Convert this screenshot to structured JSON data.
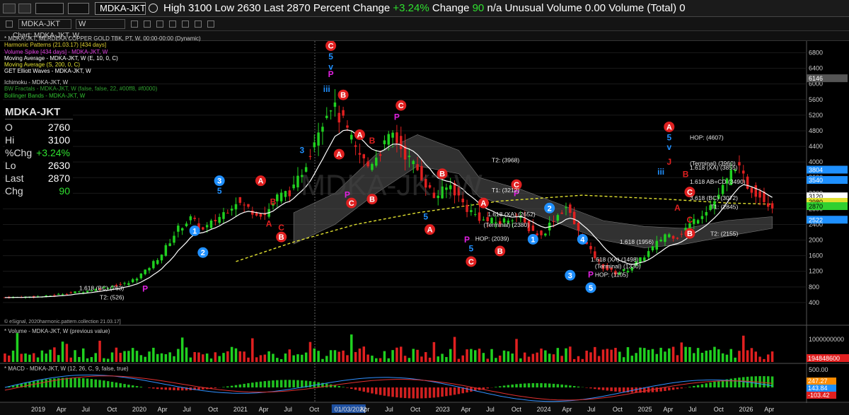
{
  "topbar": {
    "symbol": "MDKA-JKT",
    "quote_text": "High 3100  Low 2630  Last 2870  Percent Change ",
    "pct_change": "+3.24%",
    "change_label": "  Change ",
    "change_value": "90",
    "rest_text": "  n/a  Unusual Volume 0.00  Volume (Total) 0"
  },
  "toolbar": {
    "interval": "W"
  },
  "chart_title": "Chart: MDKA-JKT, W",
  "legend": [
    {
      "text": "* MDKA-JKT, MERDEKA COPPER GOLD TBK, PT, W, 00:00-00:00 (Dynamic)",
      "color": "#cccccc"
    },
    {
      "text": "Harmonic Patterns (21.03.17) [434 days]",
      "color": "#e0d030"
    },
    {
      "text": "Volume Spike [434 days] - MDKA-JKT, W",
      "color": "#e040e0"
    },
    {
      "text": "Moving Average - MDKA-JKT, W (E, 10, 0, C)",
      "color": "#ffffff"
    },
    {
      "text": "Moving Average (S, 200, 0, C)",
      "color": "#e0e030"
    },
    {
      "text": "GET Elliott Waves - MDKA-JKT, W",
      "color": "#ffffff"
    }
  ],
  "legend2": [
    {
      "text": "Ichimoku - MDKA-JKT, W",
      "color": "#cccccc"
    },
    {
      "text": "BW Fractals - MDKA-JKT, W (false, false, 22, #00ff8, #f0000)",
      "color": "#30a030"
    },
    {
      "text": "Bollinger Bands - MDKA-JKT, W",
      "color": "#30c030"
    }
  ],
  "quote_box": {
    "symbol": "MDKA-JKT",
    "rows": [
      {
        "label": "O",
        "value": "2760",
        "green": false
      },
      {
        "label": "Hi",
        "value": "3100",
        "green": false
      },
      {
        "label": "%Chg",
        "value": "+3.24%",
        "green": true
      },
      {
        "label": "Lo",
        "value": "2630",
        "green": false
      },
      {
        "label": "Last",
        "value": "2870",
        "green": false
      },
      {
        "label": "Chg",
        "value": "90",
        "green": true
      }
    ]
  },
  "credit": "© eSignal, 2020harmonic.pattern.collection 21.03.17]",
  "volume_label": "* Volume - MDKA-JKT, W (previous value)",
  "macd_label": "* MACD - MDKA-JKT, W (12, 26, C, 9, false, true)",
  "watermark": "MDKA-JKT,W",
  "chart_data": {
    "type": "candlestick",
    "price_axis": {
      "ticks": [
        400,
        800,
        1200,
        1600,
        2000,
        2400,
        2800,
        3200,
        3600,
        4000,
        4400,
        4800,
        5200,
        5600,
        6000,
        6400,
        6800
      ],
      "range": [
        0,
        7100
      ]
    },
    "price_tags": [
      {
        "value": 6146,
        "label": "6146",
        "bg": "#555555",
        "fg": "#ffffff"
      },
      {
        "value": 3804,
        "label": "3804",
        "bg": "#1e90ff",
        "fg": "#ffffff"
      },
      {
        "value": 3540,
        "label": "3540",
        "bg": "#1e90ff",
        "fg": "#ffffff"
      },
      {
        "value": 3120,
        "label": "3120",
        "bg": "#ffffff",
        "fg": "#000000"
      },
      {
        "value": 2980,
        "label": "2980",
        "bg": "#e0e030",
        "fg": "#000000"
      },
      {
        "value": 2870,
        "label": "2870",
        "bg": "#30d030",
        "fg": "#000000"
      },
      {
        "value": 2522,
        "label": "2522",
        "bg": "#1e90ff",
        "fg": "#ffffff"
      }
    ],
    "time_labels": [
      "2019",
      "Apr",
      "Jul",
      "Oct",
      "2020",
      "Apr",
      "Jul",
      "Oct",
      "2021",
      "Apr",
      "Jul",
      "Oct",
      "01/03/2022",
      "Apr",
      "Jul",
      "Oct",
      "2023",
      "Apr",
      "Jul",
      "Oct",
      "2024",
      "Apr",
      "Jul",
      "Oct",
      "2025",
      "Apr",
      "Jul",
      "Oct",
      "2026",
      "Apr"
    ],
    "close_path": [
      [
        0,
        530
      ],
      [
        10,
        560
      ],
      [
        15,
        640
      ],
      [
        20,
        700
      ],
      [
        25,
        800
      ],
      [
        30,
        900
      ],
      [
        34,
        1200
      ],
      [
        38,
        1650
      ],
      [
        42,
        2300
      ],
      [
        45,
        2550
      ],
      [
        48,
        2250
      ],
      [
        52,
        2600
      ],
      [
        56,
        3000
      ],
      [
        60,
        2750
      ],
      [
        63,
        2650
      ],
      [
        66,
        3100
      ],
      [
        70,
        3300
      ],
      [
        73,
        4000
      ],
      [
        76,
        4900
      ],
      [
        79,
        5500
      ],
      [
        82,
        5000
      ],
      [
        85,
        4300
      ],
      [
        88,
        3900
      ],
      [
        91,
        4300
      ],
      [
        94,
        4700
      ],
      [
        97,
        4200
      ],
      [
        100,
        3800
      ],
      [
        104,
        3100
      ],
      [
        108,
        3400
      ],
      [
        112,
        2800
      ],
      [
        116,
        2500
      ],
      [
        120,
        2450
      ],
      [
        124,
        2650
      ],
      [
        127,
        2300
      ],
      [
        130,
        2100
      ],
      [
        133,
        2550
      ],
      [
        136,
        2850
      ],
      [
        139,
        2200
      ],
      [
        142,
        1700
      ],
      [
        145,
        1300
      ],
      [
        148,
        1150
      ],
      [
        151,
        1250
      ],
      [
        154,
        1500
      ],
      [
        157,
        1800
      ],
      [
        160,
        2150
      ],
      [
        163,
        2100
      ],
      [
        166,
        2400
      ],
      [
        169,
        2700
      ],
      [
        172,
        3000
      ],
      [
        175,
        3500
      ],
      [
        177,
        3950
      ],
      [
        180,
        3400
      ],
      [
        183,
        3150
      ],
      [
        186,
        2870
      ]
    ],
    "bars_total": 190,
    "ma200_path": [
      [
        56,
        1450
      ],
      [
        70,
        1950
      ],
      [
        85,
        2400
      ],
      [
        100,
        2700
      ],
      [
        120,
        3000
      ],
      [
        140,
        3150
      ],
      [
        160,
        3050
      ],
      [
        175,
        2950
      ],
      [
        186,
        2920
      ]
    ],
    "cloud_upper": [
      [
        70,
        2700
      ],
      [
        80,
        3200
      ],
      [
        90,
        4200
      ],
      [
        100,
        4700
      ],
      [
        110,
        4300
      ],
      [
        115,
        3600
      ],
      [
        125,
        3300
      ],
      [
        135,
        2900
      ],
      [
        145,
        2500
      ],
      [
        155,
        2350
      ],
      [
        165,
        2300
      ],
      [
        175,
        2500
      ],
      [
        186,
        2600
      ]
    ],
    "cloud_lower": [
      [
        70,
        1900
      ],
      [
        80,
        2400
      ],
      [
        90,
        3200
      ],
      [
        100,
        3900
      ],
      [
        110,
        3700
      ],
      [
        115,
        3100
      ],
      [
        125,
        2800
      ],
      [
        135,
        2400
      ],
      [
        145,
        2000
      ],
      [
        155,
        1800
      ],
      [
        165,
        1900
      ],
      [
        175,
        2100
      ],
      [
        186,
        2300
      ]
    ],
    "wave_labels": [
      {
        "i": 79,
        "v": 6980,
        "text": "C",
        "kind": "circle",
        "color": "#e02020"
      },
      {
        "i": 79,
        "v": 6700,
        "text": "5",
        "kind": "text",
        "color": "#2090ff"
      },
      {
        "i": 79,
        "v": 6440,
        "text": "v",
        "kind": "text",
        "color": "#2090ff"
      },
      {
        "i": 79,
        "v": 6250,
        "text": "P",
        "kind": "text",
        "color": "#e020e0"
      },
      {
        "i": 78,
        "v": 5870,
        "text": "iii",
        "kind": "text",
        "color": "#2090ff"
      },
      {
        "i": 82,
        "v": 5720,
        "text": "B",
        "kind": "circle",
        "color": "#e02020"
      },
      {
        "i": 96,
        "v": 5450,
        "text": "C",
        "kind": "circle",
        "color": "#e02020"
      },
      {
        "i": 95,
        "v": 5150,
        "text": "P",
        "kind": "text",
        "color": "#e020e0"
      },
      {
        "i": 86,
        "v": 4700,
        "text": "A",
        "kind": "circle",
        "color": "#e02020"
      },
      {
        "i": 89,
        "v": 4550,
        "text": "B",
        "kind": "text",
        "color": "#e02020"
      },
      {
        "i": 81,
        "v": 4200,
        "text": "A",
        "kind": "circle",
        "color": "#e02020"
      },
      {
        "i": 72,
        "v": 4300,
        "text": "3",
        "kind": "text",
        "color": "#2090ff"
      },
      {
        "i": 52,
        "v": 3520,
        "text": "3",
        "kind": "circle",
        "color": "#2090ff"
      },
      {
        "i": 52,
        "v": 3260,
        "text": "5",
        "kind": "text",
        "color": "#2090ff"
      },
      {
        "i": 62,
        "v": 3520,
        "text": "A",
        "kind": "circle",
        "color": "#e02020"
      },
      {
        "i": 65,
        "v": 2980,
        "text": "B",
        "kind": "text",
        "color": "#e02020"
      },
      {
        "i": 64,
        "v": 2420,
        "text": "A",
        "kind": "text",
        "color": "#e02020"
      },
      {
        "i": 67,
        "v": 2320,
        "text": "C",
        "kind": "text",
        "color": "#e02020"
      },
      {
        "i": 67,
        "v": 2080,
        "text": "B",
        "kind": "circle",
        "color": "#e02020"
      },
      {
        "i": 46,
        "v": 2240,
        "text": "1",
        "kind": "circle",
        "color": "#2090ff"
      },
      {
        "i": 48,
        "v": 1680,
        "text": "2",
        "kind": "circle",
        "color": "#2090ff"
      },
      {
        "i": 34,
        "v": 750,
        "text": "P",
        "kind": "text",
        "color": "#e020e0"
      },
      {
        "i": 83,
        "v": 3160,
        "text": "P",
        "kind": "text",
        "color": "#e020e0"
      },
      {
        "i": 84,
        "v": 2950,
        "text": "C",
        "kind": "circle",
        "color": "#e02020"
      },
      {
        "i": 89,
        "v": 3050,
        "text": "B",
        "kind": "circle",
        "color": "#e02020"
      },
      {
        "i": 106,
        "v": 3700,
        "text": "B",
        "kind": "circle",
        "color": "#e02020"
      },
      {
        "i": 102,
        "v": 2600,
        "text": "5",
        "kind": "text",
        "color": "#2090ff"
      },
      {
        "i": 103,
        "v": 2270,
        "text": "A",
        "kind": "circle",
        "color": "#e02020"
      },
      {
        "i": 116,
        "v": 2950,
        "text": "A",
        "kind": "circle",
        "color": "#e02020"
      },
      {
        "i": 124,
        "v": 3420,
        "text": "C",
        "kind": "circle",
        "color": "#e02020"
      },
      {
        "i": 124,
        "v": 3200,
        "text": "P",
        "kind": "text",
        "color": "#e020e0"
      },
      {
        "i": 132,
        "v": 2820,
        "text": "2",
        "kind": "circle",
        "color": "#2090ff"
      },
      {
        "i": 128,
        "v": 2020,
        "text": "1",
        "kind": "circle",
        "color": "#2090ff"
      },
      {
        "i": 112,
        "v": 2010,
        "text": "P",
        "kind": "text",
        "color": "#e020e0"
      },
      {
        "i": 113,
        "v": 1780,
        "text": "5",
        "kind": "text",
        "color": "#2090ff"
      },
      {
        "i": 113,
        "v": 1450,
        "text": "C",
        "kind": "circle",
        "color": "#e02020"
      },
      {
        "i": 120,
        "v": 1720,
        "text": "B",
        "kind": "circle",
        "color": "#e02020"
      },
      {
        "i": 140,
        "v": 2020,
        "text": "4",
        "kind": "circle",
        "color": "#2090ff"
      },
      {
        "i": 137,
        "v": 1100,
        "text": "3",
        "kind": "circle",
        "color": "#2090ff"
      },
      {
        "i": 142,
        "v": 1110,
        "text": "P",
        "kind": "text",
        "color": "#e020e0"
      },
      {
        "i": 142,
        "v": 780,
        "text": "5",
        "kind": "circle",
        "color": "#2090ff"
      },
      {
        "i": 161,
        "v": 4900,
        "text": "A",
        "kind": "circle",
        "color": "#e02020"
      },
      {
        "i": 161,
        "v": 4630,
        "text": "5",
        "kind": "text",
        "color": "#2090ff"
      },
      {
        "i": 161,
        "v": 4380,
        "text": "v",
        "kind": "text",
        "color": "#2090ff"
      },
      {
        "i": 161,
        "v": 4000,
        "text": "J",
        "kind": "text",
        "color": "#e02020"
      },
      {
        "i": 165,
        "v": 3690,
        "text": "B",
        "kind": "text",
        "color": "#e02020"
      },
      {
        "i": 166,
        "v": 3230,
        "text": "C",
        "kind": "circle",
        "color": "#e02020"
      },
      {
        "i": 166,
        "v": 2520,
        "text": "C",
        "kind": "text",
        "color": "#e02020"
      },
      {
        "i": 166,
        "v": 2170,
        "text": "B",
        "kind": "circle",
        "color": "#e02020"
      },
      {
        "i": 163,
        "v": 2830,
        "text": "A",
        "kind": "text",
        "color": "#e02020"
      },
      {
        "i": 159,
        "v": 3750,
        "text": "iii",
        "kind": "text",
        "color": "#2090ff"
      }
    ],
    "annotations": [
      {
        "i": 118,
        "v": 4050,
        "text": "T2: (3968)"
      },
      {
        "i": 118,
        "v": 3280,
        "text": "T1: (3212)"
      },
      {
        "i": 166,
        "v": 4630,
        "text": "HOP: (4607)"
      },
      {
        "i": 166,
        "v": 3970,
        "text": "(Terminal) (3960)"
      },
      {
        "i": 166,
        "v": 3860,
        "text": "1.618 (XA) (3855)"
      },
      {
        "i": 166,
        "v": 3500,
        "text": "1.618 AB=CD (3490)"
      },
      {
        "i": 166,
        "v": 3080,
        "text": "3.618 (BC) (3072)"
      },
      {
        "i": 171,
        "v": 2850,
        "text": "T1: (2845)"
      },
      {
        "i": 171,
        "v": 2160,
        "text": "T2: (2155)"
      },
      {
        "i": 117,
        "v": 2660,
        "text": "1.618 (XA) (2652)"
      },
      {
        "i": 116,
        "v": 2390,
        "text": "(Terminal) (2380)"
      },
      {
        "i": 114,
        "v": 2040,
        "text": "HOP: (2039)"
      },
      {
        "i": 149,
        "v": 1960,
        "text": "1.618 (1956)"
      },
      {
        "i": 142,
        "v": 1500,
        "text": "1.618 (XA) (1498)"
      },
      {
        "i": 143,
        "v": 1330,
        "text": "(Terminal) (1330)"
      },
      {
        "i": 143,
        "v": 1110,
        "text": "HOP: (1105)"
      },
      {
        "i": 18,
        "v": 770,
        "text": "1.618 (BC) (763)"
      },
      {
        "i": 23,
        "v": 530,
        "text": "T2: (526)"
      }
    ],
    "volume_axis": {
      "ticks": [
        {
          "value": 1000000000,
          "label": "1000000000"
        }
      ],
      "last": "194848600"
    },
    "macd_axis": {
      "ticks": [
        {
          "value": 500,
          "label": "500.00"
        }
      ],
      "tags": [
        "247.27",
        "143.84",
        "-103.42"
      ]
    }
  }
}
